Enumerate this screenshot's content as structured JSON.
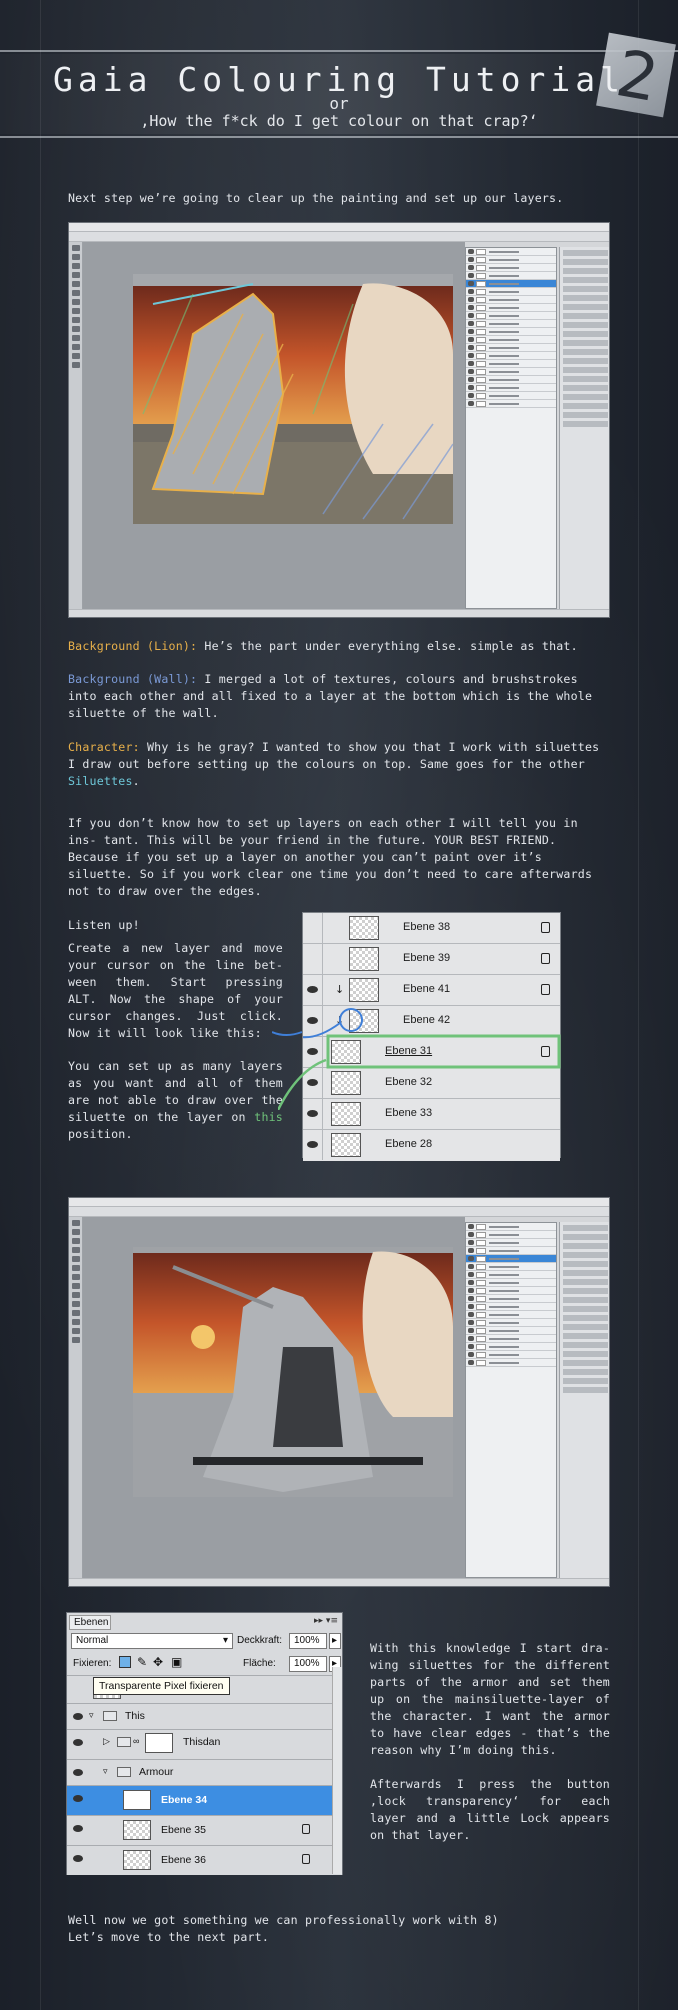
{
  "header": {
    "title": "Gaia Colouring Tutorial",
    "or": "or",
    "subtitle": "‚How the f*ck do I get colour on that crap?‘",
    "part_number": "2"
  },
  "intro": "Next step we’re going to clear up the painting and set up our layers.",
  "legend": {
    "lion_label": "Background (Lion):",
    "lion_text": " He’s the part under everything else. simple as that.",
    "wall_label": "Background (Wall):",
    "wall_text": " I merged a lot of textures, colours and brushstrokes into each other and all fixed to a layer at the bottom which is the whole siluette of the wall.",
    "char_label": "Character:",
    "char_text": " Why is he gray? I wanted to show you that I work with siluettes I draw out before setting up the colours on top. Same goes for the other ",
    "siluettes_word": "Siluettes",
    "siluettes_end": "."
  },
  "paragraph_layers": "If you don’t know how to set up layers on each other I will tell you in ins- tant. This will be your friend in the future. YOUR BEST FRIEND. Because if you set up a layer on another you can’t paint over it’s siluette. So if you work clear one time you don’t need to care afterwards not to draw over the edges.",
  "listen": {
    "heading": "Listen up!",
    "body": "Create a new layer and move your cursor on the line bet- ween them. Start pressing ALT. Now the shape of your cursor changes. Just click. Now it will look like this:",
    "body2_start": "You can set up as many layers as you want and all of them are not able to draw over the siluette on the layer on ",
    "this_word": "this",
    "body2_end": " position."
  },
  "layers_closeup": {
    "rows": [
      {
        "name": "Ebene 38",
        "lock": true
      },
      {
        "name": "Ebene 39",
        "lock": true
      },
      {
        "name": "Ebene 41",
        "lock": true
      },
      {
        "name": "Ebene 42",
        "lock": false
      },
      {
        "name": "Ebene 31",
        "lock": true
      },
      {
        "name": "Ebene 32",
        "lock": false
      },
      {
        "name": "Ebene 33",
        "lock": false
      },
      {
        "name": "Ebene 28",
        "lock": false
      }
    ]
  },
  "layers_panel": {
    "tab": "Ebenen",
    "blend_mode": "Normal",
    "opacity_label": "Deckkraft:",
    "opacity_value": "100%",
    "lock_label": "Fixieren:",
    "fill_label": "Fläche:",
    "fill_value": "100%",
    "tooltip": "Transparente Pixel fixieren",
    "rows": [
      {
        "name": "This",
        "kind": "folder"
      },
      {
        "name": "Thisdan",
        "kind": "layer"
      },
      {
        "name": "Armour",
        "kind": "folder"
      },
      {
        "name": "Ebene 34",
        "kind": "layer"
      },
      {
        "name": "Ebene 35",
        "kind": "layer"
      },
      {
        "name": "Ebene 36",
        "kind": "layer"
      }
    ]
  },
  "right_text": {
    "p1": "With this knowledge I start dra- wing siluettes for the different parts of the armor and set them up on the mainsiluette-layer of the character. I want the armor to have clear edges - that’s the reason why I’m doing this.",
    "p2": "Afterwards I press the button ‚lock transparency‘ for each layer and a little Lock appears on that layer."
  },
  "outro": {
    "line1": "Well now we got something we can professionally work with 8)",
    "line2": "Let’s move to the next part."
  },
  "colors": {
    "lion": "#e8b04a",
    "wall": "#7b9ad6",
    "character": "#e8b04a",
    "highlight_green": "#6fc27a",
    "selected_layer": "#3d8ee2"
  }
}
